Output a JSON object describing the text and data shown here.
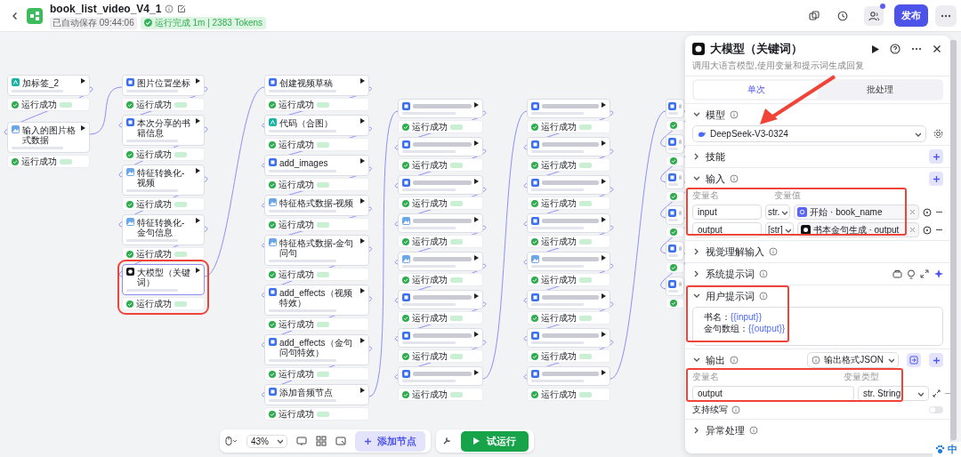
{
  "header": {
    "title": "book_list_video_V4_1",
    "autosave": "已自动保存 09:44:06",
    "run_status": {
      "kind": "success",
      "text": "运行完成 1m | 2383 Tokens"
    },
    "notification_dot": true,
    "publish": "发布"
  },
  "canvas": {
    "columns": [
      {
        "nodes": [
          {
            "kind": "code",
            "title": "加标签_2",
            "status": "运行成功",
            "highlighted": false
          },
          {
            "kind": "image",
            "title": "输入的图片格式数据",
            "status": "运行成功",
            "highlighted": false
          }
        ]
      },
      {
        "nodes": [
          {
            "kind": "plugin",
            "title": "图片位置坐标",
            "status": "运行成功",
            "highlighted": false
          },
          {
            "kind": "plugin",
            "title": "本次分享的书籍信息",
            "status": "运行成功",
            "highlighted": false
          },
          {
            "kind": "image",
            "title": "特征转换化-视频",
            "status": "运行成功",
            "highlighted": false
          },
          {
            "kind": "image",
            "title": "特征转换化-金句信息",
            "status": "运行成功",
            "highlighted": false
          },
          {
            "kind": "llm",
            "title": "大模型（关键词）",
            "status": "运行成功",
            "highlighted": true
          }
        ]
      },
      {
        "nodes": [
          {
            "kind": "plugin",
            "title": "创建视频草稿",
            "status": "运行成功",
            "highlighted": false
          },
          {
            "kind": "code",
            "title": "代码（合图）",
            "status": "运行成功",
            "highlighted": false
          },
          {
            "kind": "plugin",
            "title": "add_images",
            "status": "运行成功",
            "highlighted": false
          },
          {
            "kind": "image",
            "title": "特征格式数据-视频",
            "status": "运行成功",
            "highlighted": false
          },
          {
            "kind": "image",
            "title": "特征格式数据-金句问句",
            "status": "运行成功",
            "highlighted": false
          },
          {
            "kind": "plugin",
            "title": "add_effects（视频特效）",
            "status": "运行成功",
            "highlighted": false
          },
          {
            "kind": "plugin",
            "title": "add_effects（金句问句特效）",
            "status": "运行成功",
            "highlighted": false
          },
          {
            "kind": "plugin",
            "title": "添加音频节点",
            "status": "运行成功",
            "highlighted": false
          }
        ]
      },
      {
        "nodes": [
          {
            "kind": "plugin",
            "status": "运行成功",
            "highlighted": false
          },
          {
            "kind": "plugin",
            "status": "运行成功",
            "highlighted": false
          },
          {
            "kind": "plugin",
            "status": "运行成功",
            "highlighted": false
          },
          {
            "kind": "image",
            "status": "运行成功",
            "highlighted": false
          },
          {
            "kind": "image",
            "status": "运行成功",
            "highlighted": false
          },
          {
            "kind": "plugin",
            "status": "运行成功",
            "highlighted": false
          },
          {
            "kind": "plugin",
            "status": "运行成功",
            "highlighted": false
          },
          {
            "kind": "plugin",
            "status": "运行成功",
            "highlighted": false
          }
        ]
      },
      {
        "nodes": [
          {
            "kind": "plugin",
            "status": "运行成功",
            "highlighted": false
          },
          {
            "kind": "plugin",
            "status": "运行成功",
            "highlighted": false
          },
          {
            "kind": "plugin",
            "status": "运行成功",
            "highlighted": false
          },
          {
            "kind": "plugin",
            "status": "运行成功",
            "highlighted": false
          },
          {
            "kind": "image",
            "status": "运行成功",
            "highlighted": false
          },
          {
            "kind": "plugin",
            "status": "运行成功",
            "highlighted": false
          },
          {
            "kind": "plugin",
            "status": "运行成功",
            "highlighted": false
          },
          {
            "kind": "plugin",
            "status": "运行成功",
            "highlighted": false
          }
        ]
      },
      {
        "nodes": [
          {
            "kind": "plugin",
            "highlighted": false
          },
          {
            "kind": "plugin",
            "highlighted": false
          },
          {
            "kind": "plugin",
            "highlighted": false
          },
          {
            "kind": "plugin",
            "highlighted": false
          },
          {
            "kind": "plugin",
            "highlighted": false
          },
          {
            "kind": "plugin",
            "highlighted": false
          }
        ]
      }
    ]
  },
  "panel": {
    "title": "大模型（关键词）",
    "description": "调用大语言模型,使用变量和提示词生成回复",
    "tabs": [
      {
        "label": "单次",
        "selected": true
      },
      {
        "label": "批处理",
        "selected": false
      }
    ],
    "model": {
      "label": "模型",
      "expanded": true,
      "value": "DeepSeek-V3-0324",
      "arrow_pointer": true
    },
    "skills": {
      "label": "技能",
      "expanded": false
    },
    "input": {
      "label": "输入",
      "expanded": true,
      "highlighted": true,
      "name_header": "变量名",
      "value_header": "变量值",
      "rows": [
        {
          "name": "input",
          "type": "str.",
          "kind": "start",
          "source": "开始 · book_name"
        },
        {
          "name": "output",
          "type": "[str]",
          "kind": "llm",
          "source": "书本金句生成 · output"
        }
      ]
    },
    "vision": {
      "label": "视觉理解输入",
      "expanded": false
    },
    "system_prompt": {
      "label": "系统提示词",
      "expanded": false
    },
    "user_prompt": {
      "label": "用户提示词",
      "expanded": true,
      "highlighted": true,
      "lines": [
        {
          "label": "书名：",
          "variable": "{{input}}"
        },
        {
          "label": "金句数组：",
          "variable": "{{output}}"
        }
      ]
    },
    "output": {
      "label": "输出",
      "expanded": true,
      "highlighted": true,
      "format": "输出格式JSON",
      "name_header": "变量名",
      "type_header": "变量类型",
      "rows": [
        {
          "name": "output",
          "type": "str. String"
        }
      ],
      "continue": {
        "label": "支持续写",
        "on": false
      }
    },
    "error": {
      "label": "异常处理",
      "expanded": false
    }
  },
  "toolbar": {
    "zoom": "43%",
    "add_node": "添加节点",
    "run": "试运行"
  },
  "ime": {
    "text": "中"
  }
}
